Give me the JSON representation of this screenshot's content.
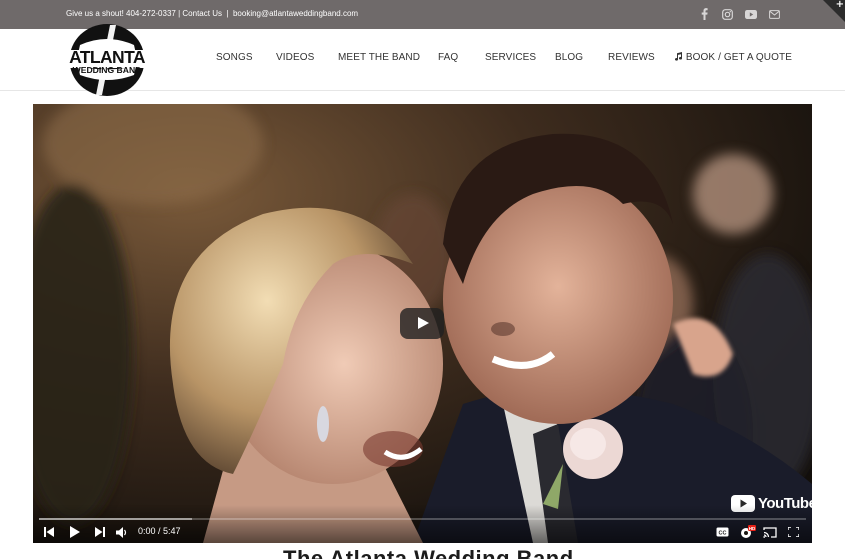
{
  "topbar": {
    "phone_text": "Give us a shout! 404-272-0337",
    "separator1": "|",
    "contact_link": "Contact Us",
    "separator2": "|",
    "email": "booking@atlantaweddingband.com",
    "social_icons": [
      "facebook-icon",
      "instagram-icon",
      "youtube-icon",
      "email-icon"
    ],
    "background": "#6f6a6a"
  },
  "logo": {
    "line1": "ATLANTA",
    "line2": "WEDDING BAND"
  },
  "nav": {
    "items": [
      "SONGS",
      "VIDEOS",
      "MEET THE BAND",
      "FAQ",
      "SERVICES",
      "BLOG",
      "REVIEWS"
    ],
    "cta_label": "BOOK / GET A QUOTE",
    "cta_icon": "music-note-icon"
  },
  "video": {
    "current_time": "0:00 / 5:47",
    "youtube_label": "YouTube",
    "loaded_fraction": 0.2,
    "controls": [
      "previous-icon",
      "play-icon",
      "next-icon",
      "volume-icon",
      "captions-icon",
      "settings-icon",
      "cast-icon",
      "fullscreen-icon"
    ],
    "settings_badge": "HD"
  },
  "below": {
    "title": "The Atlanta Wedding Band"
  }
}
